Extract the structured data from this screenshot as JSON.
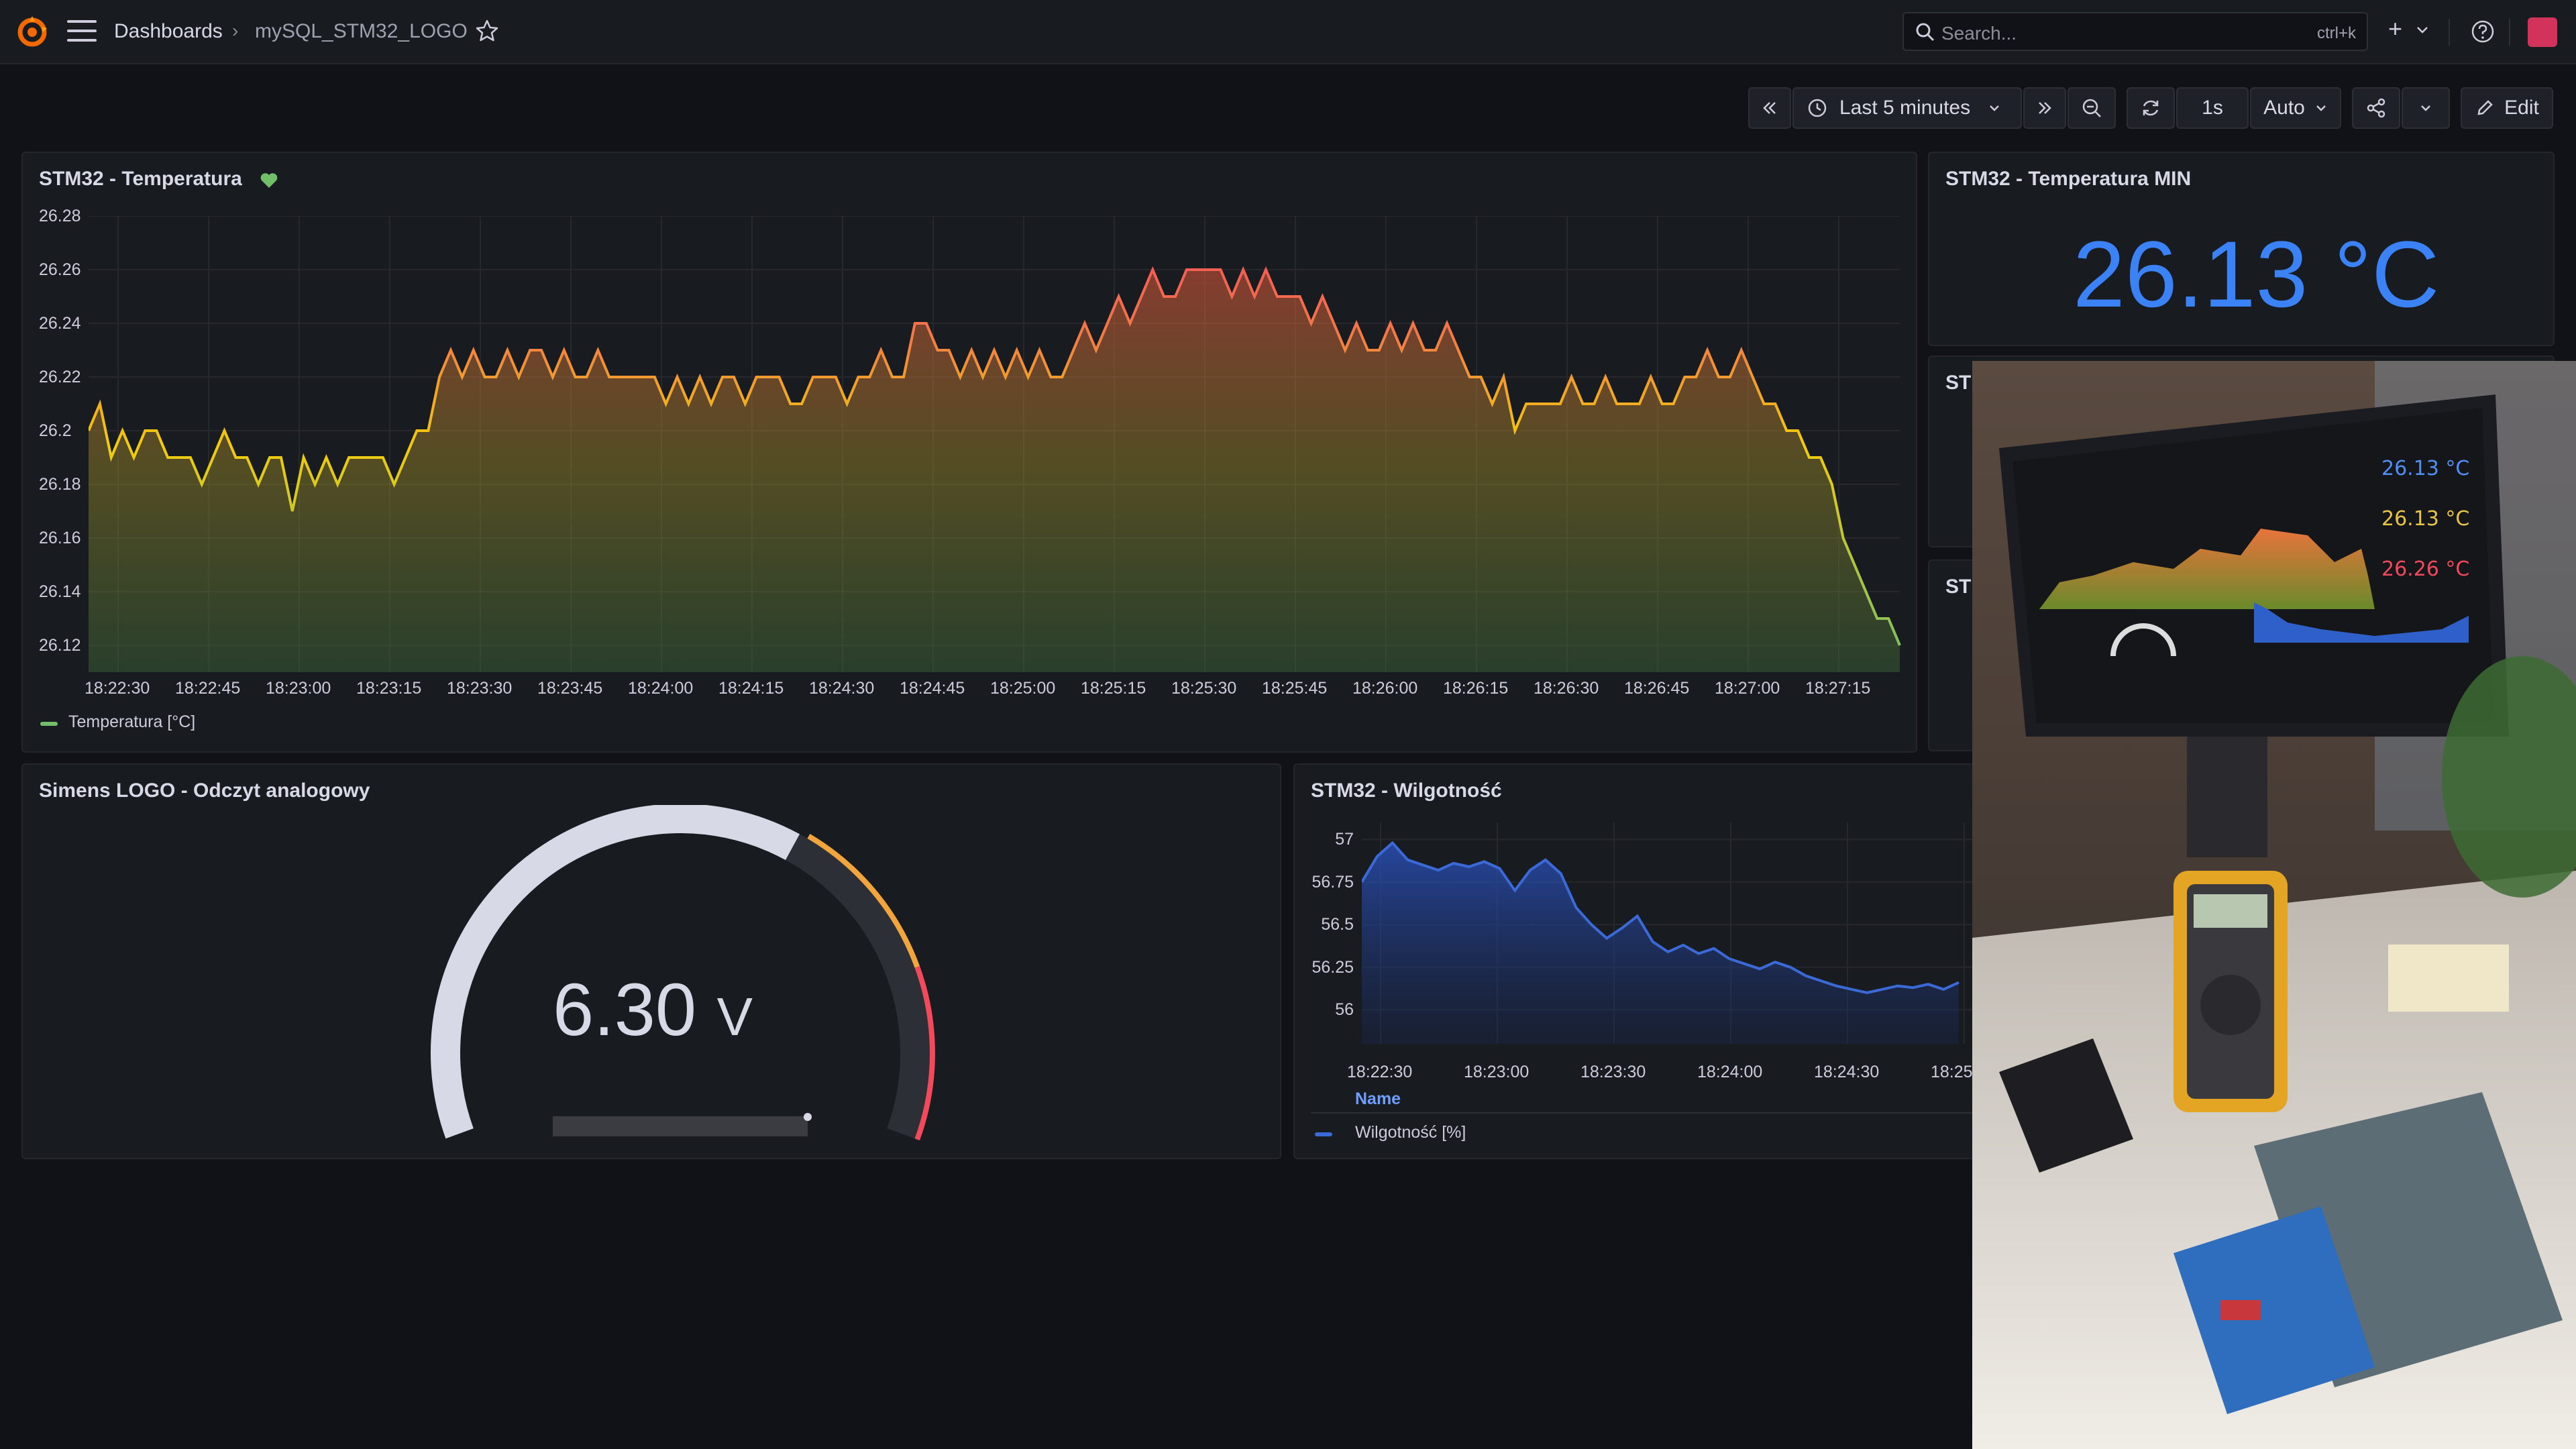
{
  "header": {
    "breadcrumb_root": "Dashboards",
    "breadcrumb_sep": "›",
    "breadcrumb_current": "mySQL_STM32_LOGO",
    "search_placeholder": "Search...",
    "search_shortcut": "ctrl+k",
    "plus_label": "+"
  },
  "toolbar": {
    "time_range": "Last 5 minutes",
    "refresh_interval": "1s",
    "auto": "Auto",
    "edit": "Edit"
  },
  "colors": {
    "accent_blue": "#3b82f6",
    "green": "#73bf69",
    "yellow": "#fade2a",
    "red": "#f2495c"
  },
  "panels": {
    "temp": {
      "title": "STM32 - Temperatura",
      "legend": "Temperatura [°C]",
      "yticks": [
        "26.28",
        "26.26",
        "26.24",
        "26.22",
        "26.2",
        "26.18",
        "26.16",
        "26.14",
        "26.12"
      ],
      "xticks": [
        "18:22:30",
        "18:22:45",
        "18:23:00",
        "18:23:15",
        "18:23:30",
        "18:23:45",
        "18:24:00",
        "18:24:15",
        "18:24:30",
        "18:24:45",
        "18:25:00",
        "18:25:15",
        "18:25:30",
        "18:25:45",
        "18:26:00",
        "18:26:15",
        "18:26:30",
        "18:26:45",
        "18:27:00",
        "18:27:15"
      ]
    },
    "temp_min": {
      "title": "STM32 - Temperatura MIN",
      "value": "26.13 °C"
    },
    "stub1": {
      "title": "ST"
    },
    "stub2": {
      "title": "ST"
    },
    "gauge": {
      "title": "Simens LOGO - Odczyt analogowy",
      "value": "6.30",
      "unit": "V"
    },
    "hum": {
      "title": "STM32 - Wilgotność",
      "yticks": [
        "57",
        "56.75",
        "56.5",
        "56.25",
        "56"
      ],
      "xticks": [
        "18:22:30",
        "18:23:00",
        "18:23:30",
        "18:24:00",
        "18:24:30",
        "18:25"
      ],
      "legend_header": "Name",
      "legend": "Wilgotność [%]"
    }
  },
  "chart_data": [
    {
      "type": "area",
      "title": "STM32 - Temperatura",
      "ylim": [
        26.11,
        26.28
      ],
      "series": [
        {
          "name": "Temperatura [°C]",
          "values": [
            26.2,
            26.21,
            26.19,
            26.2,
            26.19,
            26.2,
            26.2,
            26.19,
            26.19,
            26.19,
            26.18,
            26.19,
            26.2,
            26.19,
            26.19,
            26.18,
            26.19,
            26.19,
            26.17,
            26.19,
            26.18,
            26.19,
            26.18,
            26.19,
            26.19,
            26.19,
            26.19,
            26.18,
            26.19,
            26.2,
            26.2,
            26.22,
            26.23,
            26.22,
            26.23,
            26.22,
            26.22,
            26.23,
            26.22,
            26.23,
            26.23,
            26.22,
            26.23,
            26.22,
            26.22,
            26.23,
            26.22,
            26.22,
            26.22,
            26.22,
            26.22,
            26.21,
            26.22,
            26.21,
            26.22,
            26.21,
            26.22,
            26.22,
            26.21,
            26.22,
            26.22,
            26.22,
            26.21,
            26.21,
            26.22,
            26.22,
            26.22,
            26.21,
            26.22,
            26.22,
            26.23,
            26.22,
            26.22,
            26.24,
            26.24,
            26.23,
            26.23,
            26.22,
            26.23,
            26.22,
            26.23,
            26.22,
            26.23,
            26.22,
            26.23,
            26.22,
            26.22,
            26.23,
            26.24,
            26.23,
            26.24,
            26.25,
            26.24,
            26.25,
            26.26,
            26.25,
            26.25,
            26.26,
            26.26,
            26.26,
            26.26,
            26.25,
            26.26,
            26.25,
            26.26,
            26.25,
            26.25,
            26.25,
            26.24,
            26.25,
            26.24,
            26.23,
            26.24,
            26.23,
            26.23,
            26.24,
            26.23,
            26.24,
            26.23,
            26.23,
            26.24,
            26.23,
            26.22,
            26.22,
            26.21,
            26.22,
            26.2,
            26.21,
            26.21,
            26.21,
            26.21,
            26.22,
            26.21,
            26.21,
            26.22,
            26.21,
            26.21,
            26.21,
            26.22,
            26.21,
            26.21,
            26.22,
            26.22,
            26.23,
            26.22,
            26.22,
            26.23,
            26.22,
            26.21,
            26.21,
            26.2,
            26.2,
            26.19,
            26.19,
            26.18,
            26.16,
            26.15,
            26.14,
            26.13,
            26.13,
            26.12
          ]
        }
      ]
    },
    {
      "type": "area",
      "title": "STM32 - Wilgotność",
      "ylim": [
        55.8,
        57.1
      ],
      "series": [
        {
          "name": "Wilgotność [%]",
          "values": [
            56.75,
            56.9,
            56.98,
            56.88,
            56.85,
            56.82,
            56.86,
            56.84,
            56.87,
            56.83,
            56.7,
            56.82,
            56.88,
            56.8,
            56.6,
            56.5,
            56.42,
            56.48,
            56.55,
            56.4,
            56.34,
            56.38,
            56.33,
            56.36,
            56.3,
            56.27,
            56.24,
            56.28,
            56.25,
            56.2,
            56.17,
            56.14,
            56.12,
            56.1,
            56.12,
            56.14,
            56.13,
            56.15,
            56.12,
            56.16
          ]
        }
      ]
    },
    {
      "type": "gauge",
      "title": "Simens LOGO - Odczyt analogowy",
      "value": 6.3,
      "unit": "V",
      "ylim": [
        0,
        10
      ]
    }
  ]
}
